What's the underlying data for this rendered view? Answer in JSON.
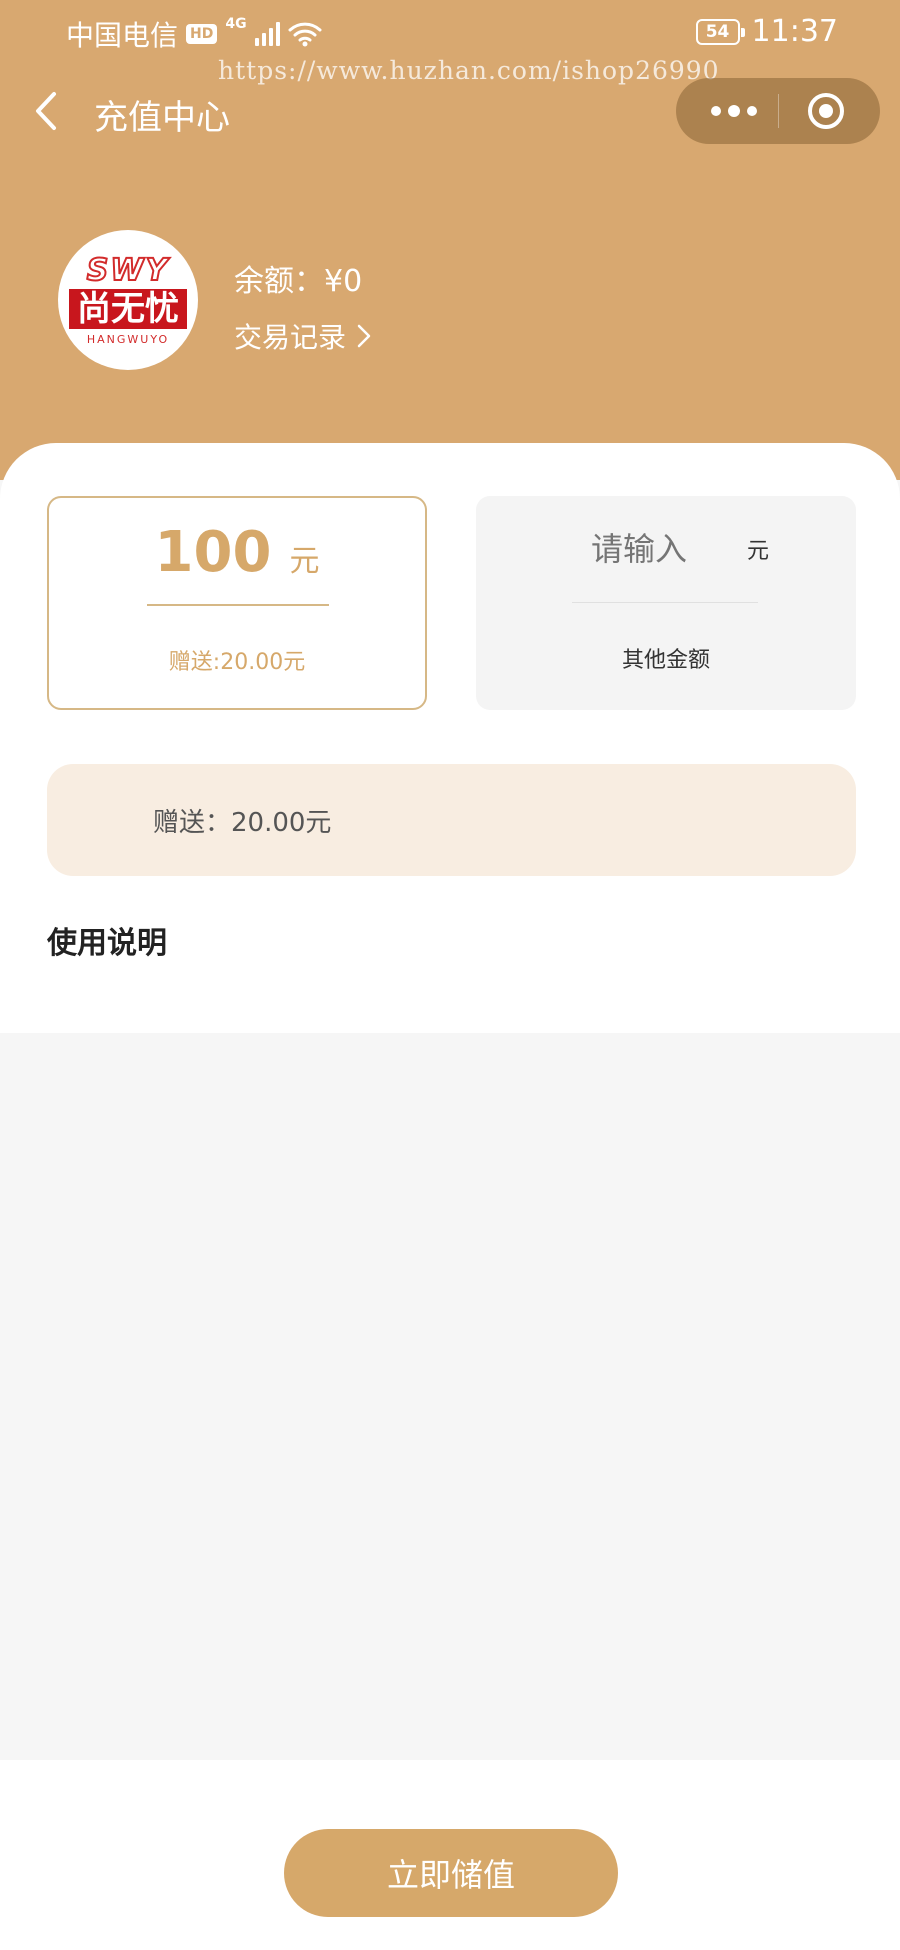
{
  "status_bar": {
    "carrier": "中国电信",
    "hd_badge": "HD",
    "network": "4G",
    "battery": "54",
    "time": "11:37"
  },
  "watermark": "https://www.huzhan.com/ishop26990",
  "nav": {
    "title": "充值中心"
  },
  "profile": {
    "avatar_logo_text": "SWY 尚无忧 HANGWUYO",
    "balance_label": "余额：¥0",
    "records_label": "交易记录"
  },
  "options": {
    "selected": {
      "amount": "100",
      "unit": "元",
      "bonus": "赠送:20.00元"
    },
    "custom": {
      "placeholder": "请输入",
      "unit": "元",
      "label": "其他金额"
    }
  },
  "bonus_banner": "赠送：20.00元",
  "usage_title": "使用说明",
  "recharge_button": "立即储值",
  "colors": {
    "header": "#d8a870",
    "accent": "#d6a86a",
    "banner_bg": "#f8ede1"
  },
  "icons": [
    "back-icon",
    "more-icon",
    "close-icon",
    "chevron-right-icon",
    "wifi-icon",
    "signal-icon"
  ]
}
